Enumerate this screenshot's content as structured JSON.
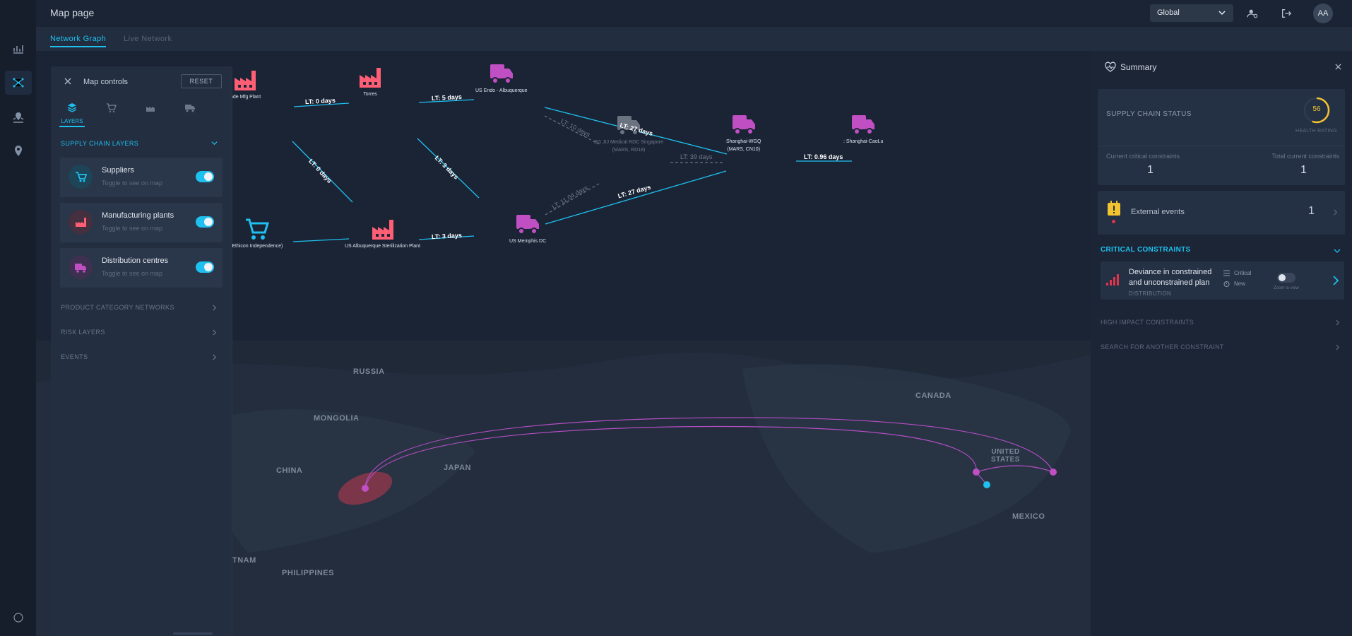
{
  "header": {
    "page_title": "Map page",
    "region": "Global",
    "avatar_initials": "AA"
  },
  "tabs": [
    {
      "label": "Network Graph",
      "active": true
    },
    {
      "label": "Live Network",
      "active": false
    }
  ],
  "rail": {
    "items": [
      "chart-icon",
      "network-icon",
      "map-pin-layers-icon",
      "location-pin-icon"
    ],
    "footer_icon": "circle-icon"
  },
  "map_controls": {
    "title": "Map controls",
    "reset_label": "RESET",
    "active_tab_label": "LAYERS",
    "tab_icons": [
      "layers-icon",
      "cart-icon",
      "factory-icon",
      "truck-icon"
    ],
    "sections": {
      "supply_chain_layers": "SUPPLY CHAIN LAYERS",
      "product_category_networks": "PRODUCT CATEGORY NETWORKS",
      "risk_layers": "RISK LAYERS",
      "events": "EVENTS"
    },
    "layers": [
      {
        "name": "Suppliers",
        "hint": "Toggle to see on map",
        "enabled": true,
        "color": "#1ec0ef",
        "icon": "cart-icon"
      },
      {
        "name": "Manufacturing plants",
        "hint": "Toggle to see on map",
        "enabled": true,
        "color": "#ff5e75",
        "icon": "factory-icon"
      },
      {
        "name": "Distribution centres",
        "hint": "Toggle to see on map",
        "enabled": true,
        "color": "#c04fc4",
        "icon": "truck-icon"
      }
    ]
  },
  "graph": {
    "nodes": {
      "inde_mfg": "Inde Mfg Plant",
      "torres": "Torres",
      "us_endo": "US Endo - Albuquerque",
      "sg_rdc": "SG JIJ Medical RDC Singapore",
      "sg_rdc_sub": "(MARS, RD18)",
      "shanghai_wgq": "Shanghai-WGQ",
      "shanghai_wgq_sub": "(MARS, CN10)",
      "shanghai_caolu": ": Shanghai-CaoLu",
      "ethicon": "(Ethicon Independence)",
      "us_albuquerque": "US Albuquerque Sterilization Plant",
      "us_memphis": "US Memphis DC"
    },
    "lead_times": {
      "inde_torres": "LT: 0 days",
      "torres_endo": "LT: 5 days",
      "endo_wgq": "LT: 27 days",
      "endo_sg": "LT: 10 days",
      "sg_wgq": "LT: 39 days",
      "wgq_caolu": "LT: 0.96 days",
      "inde_albuq": "LT: 0 days",
      "torres_memphis": "LT: 3 days",
      "albuq_memphis": "LT: 3 days",
      "memphis_sg": "LT: 11.04 days",
      "memphis_wgq": "LT: 27 days"
    },
    "colors": {
      "supplier": "#1ec0ef",
      "plant": "#ff5e75",
      "dc": "#c04fc4",
      "inactive": "#6b7280",
      "link": "#1ec0ef"
    }
  },
  "map": {
    "labels": {
      "russia": "RUSSIA",
      "mongolia": "MONGOLIA",
      "china": "CHINA",
      "japan": "JAPAN",
      "vietnam": "TNAM",
      "philippines": "PHILIPPINES",
      "canada": "CANADA",
      "united_states": "UNITED\nSTATES",
      "mexico": "MEXICO"
    }
  },
  "summary": {
    "title": "Summary",
    "status_label": "SUPPLY CHAIN STATUS",
    "health_rating": 56,
    "health_label": "HEALTH RATING",
    "current_critical_label": "Current critical constraints",
    "current_critical_value": "1",
    "total_current_label": "Total current constraints",
    "total_current_value": "1",
    "external_events_label": "External events",
    "external_events_count": "1",
    "critical_constraints_label": "CRITICAL CONSTRAINTS",
    "constraint": {
      "title": "Deviance in constrained and unconstrained plan",
      "category": "DISTRIBUTION",
      "severity": "Critical",
      "status": "New",
      "zoom_label": "Zoom to view"
    },
    "high_impact_label": "HIGH IMPACT CONSTRAINTS",
    "search_label": "SEARCH FOR ANOTHER CONSTRAINT",
    "accent": "#1ec0ef",
    "gauge_color": "#f4c430"
  }
}
